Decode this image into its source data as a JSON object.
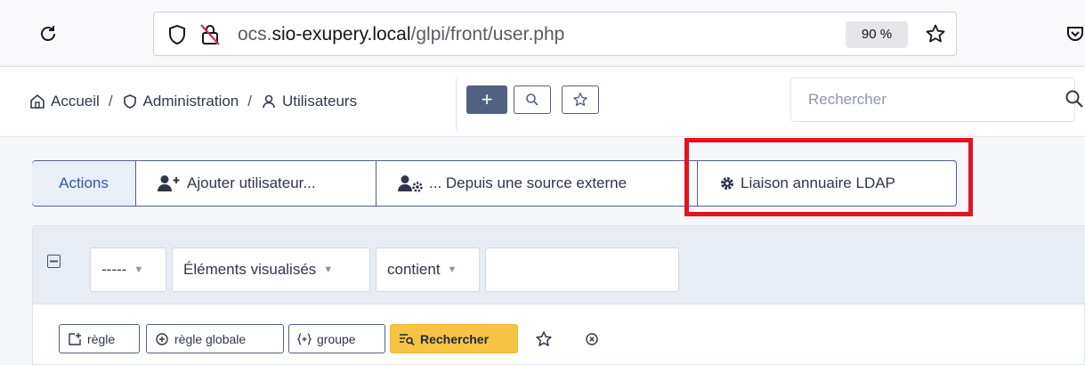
{
  "browser": {
    "url_prefix": "ocs.",
    "url_domain": "sio-exupery.local",
    "url_path": "/glpi/front/user.php",
    "zoom": "90 %"
  },
  "header": {
    "breadcrumbs": [
      "Accueil",
      "Administration",
      "Utilisateurs"
    ],
    "separator": "/",
    "add_label": "+",
    "search_placeholder": "Rechercher"
  },
  "actions": {
    "label": "Actions",
    "add_user": "Ajouter utilisateur...",
    "external_source": "... Depuis une source externe",
    "ldap_link": "Liaison annuaire LDAP",
    "highlight_color": "#e3131f"
  },
  "criteria": {
    "field": "-----",
    "item": "Éléments visualisés",
    "operator": "contient",
    "value": ""
  },
  "search_buttons": {
    "rule": "règle",
    "global_rule": "règle globale",
    "group": "groupe",
    "search": "Rechercher"
  },
  "colors": {
    "accent": "#526183",
    "search_button": "#f6c344",
    "actions_label": "#2f5da7"
  }
}
